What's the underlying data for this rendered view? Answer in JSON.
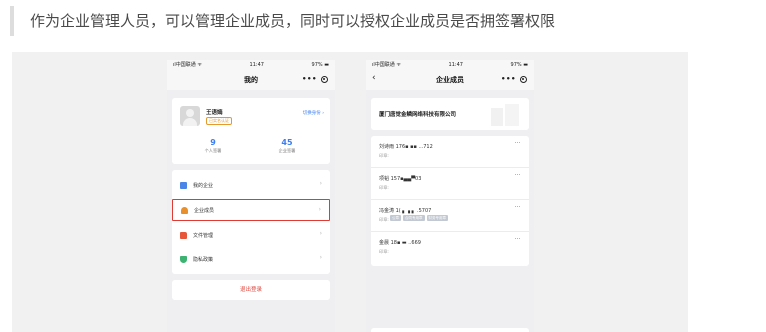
{
  "caption": "作为企业管理人员，可以管理企业成员，同时可以授权企业成员是否拥签署权限",
  "left_phone": {
    "status": {
      "carrier": "ıl中国联通 ᯤ",
      "time": "11:47",
      "battery": "97% ▬"
    },
    "nav_title": "我的",
    "profile": {
      "name": "王语嫣",
      "badge": "已实名认证",
      "switch_label": "切换身份 ›",
      "stats": [
        {
          "value": "9",
          "label": "个人签署"
        },
        {
          "value": "45",
          "label": "企业签署"
        }
      ]
    },
    "menu": [
      {
        "label": "我的企业",
        "icon": "building-icon",
        "color": "#4a86e8"
      },
      {
        "label": "企业成员",
        "icon": "members-icon",
        "color": "#e8902e",
        "highlighted": true
      },
      {
        "label": "文件管理",
        "icon": "folder-icon",
        "color": "#e8563a"
      },
      {
        "label": "隐私政策",
        "icon": "shield-icon",
        "color": "#3cb371"
      }
    ],
    "logout": "退出登录",
    "highlight_color": "#e03a34"
  },
  "right_phone": {
    "status": {
      "carrier": "ıl中国联通 ᯤ",
      "time": "11:47",
      "battery": "97% ▬"
    },
    "back": "‹",
    "nav_title": "企业成员",
    "company_name": "厦门唐觉金鳞网络科技有限公司",
    "members": [
      {
        "name": "刘诗雨 176▪ ▪▪ ...712",
        "label": "印章:",
        "tags": []
      },
      {
        "name": "项韬 157▪▄▄▀03",
        "label": "印章:",
        "tags": []
      },
      {
        "name": "冯金涛 1( ▖▗ ▖ .5707",
        "label": "印章:",
        "tags": [
          "公章",
          "合同专用章",
          "财务专用章"
        ]
      },
      {
        "name": "金晨 18▪ ▬ ..669",
        "label": "印章:",
        "tags": []
      }
    ],
    "more": "···"
  },
  "colors": {
    "accent": "#3c7ef2",
    "canvas": "#f1f1f1"
  }
}
